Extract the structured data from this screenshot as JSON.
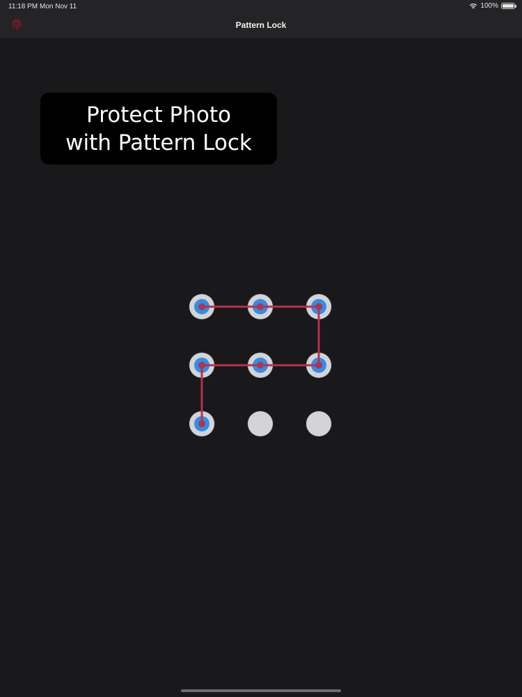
{
  "status_bar": {
    "time": "11:18 PM",
    "date": "Mon Nov 11",
    "battery": "100%",
    "battery_level": 1.0,
    "wifi_icon": "wifi-icon",
    "battery_icon": "battery-icon"
  },
  "nav": {
    "title": "Pattern Lock",
    "left_icon": "fingerprint-icon",
    "left_icon_color": "#7a1a22"
  },
  "banner": {
    "line1": "Protect Photo",
    "line2": "with Pattern Lock"
  },
  "pattern": {
    "rows": 3,
    "cols": 3,
    "sequence": [
      7,
      4,
      5,
      6,
      3,
      2,
      1
    ],
    "selected_dots": [
      1,
      2,
      3,
      4,
      5,
      6,
      7
    ],
    "dot_color": "#d4d3d5",
    "selected_ring_color": "#2f8fe8",
    "line_color": "#b9304a"
  },
  "colors": {
    "background": "#19181a",
    "bar": "#242325"
  }
}
